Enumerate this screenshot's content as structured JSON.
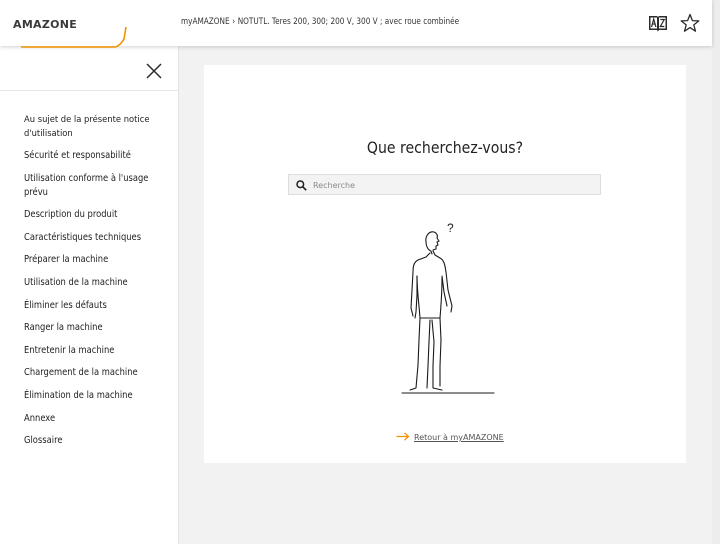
{
  "header": {
    "logo_text": "AMAZONE",
    "breadcrumb": [
      {
        "label": "myAMAZONE"
      },
      {
        "label": "NOTUTL. Teres 200, 300; 200 V, 300 V ; avec roue combinée"
      }
    ],
    "breadcrumb_separator": "›",
    "icons": [
      "glossary-book-icon",
      "favorite-star-icon"
    ]
  },
  "sidebar": {
    "close_icon": "close-icon",
    "items": [
      {
        "label": "Au sujet de la présente notice d'utilisation"
      },
      {
        "label": "Sécurité et responsabilité"
      },
      {
        "label": "Utilisation conforme à l'usage prévu"
      },
      {
        "label": "Description du produit"
      },
      {
        "label": "Caractéristiques techniques"
      },
      {
        "label": "Préparer la machine"
      },
      {
        "label": "Utilisation de la machine"
      },
      {
        "label": "Éliminer les défauts"
      },
      {
        "label": "Ranger la machine"
      },
      {
        "label": "Entretenir la machine"
      },
      {
        "label": "Chargement de la machine"
      },
      {
        "label": "Élimination de la machine"
      },
      {
        "label": "Annexe"
      },
      {
        "label": "Glossaire"
      }
    ]
  },
  "main": {
    "title": "Que recherchez-vous?",
    "search": {
      "placeholder": "Recherche",
      "value": ""
    },
    "back_link": "Retour à myAMAZONE",
    "illustration_glyph": "?"
  },
  "colors": {
    "accent": "#f39200",
    "text": "#222222",
    "background": "#f2f2f2"
  }
}
